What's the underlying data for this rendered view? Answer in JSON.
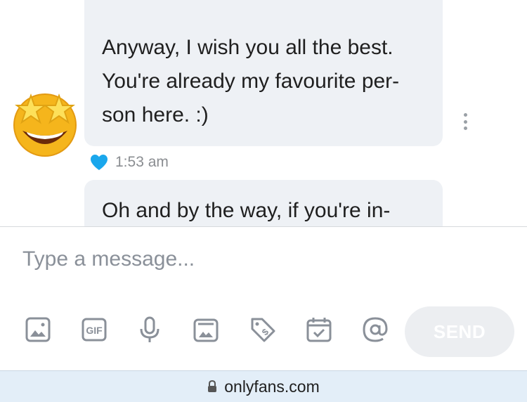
{
  "messages": [
    {
      "lines": [
        "Anyway, I wish you all the best.",
        "You're already my favourite per-",
        "son here. :)"
      ],
      "avatar_icon": "star-struck-emoji-icon",
      "liked": true,
      "time": "1:53 am"
    },
    {
      "lines": [
        "Oh and by the way, if you're in-"
      ]
    }
  ],
  "composer": {
    "placeholder": "Type a message...",
    "tools": [
      "image-icon",
      "gif-icon",
      "microphone-icon",
      "vault-media-icon",
      "price-tag-icon",
      "schedule-calendar-icon",
      "mention-icon"
    ],
    "gif_label": "GIF",
    "send_label": "SEND"
  },
  "browser": {
    "domain": "onlyfans.com"
  },
  "colors": {
    "bubble_bg": "#eef1f5",
    "heart": "#1aa7ec",
    "icon": "#8a9099",
    "send_bg": "#eceef1",
    "url_bar_bg": "#e3eef8"
  }
}
